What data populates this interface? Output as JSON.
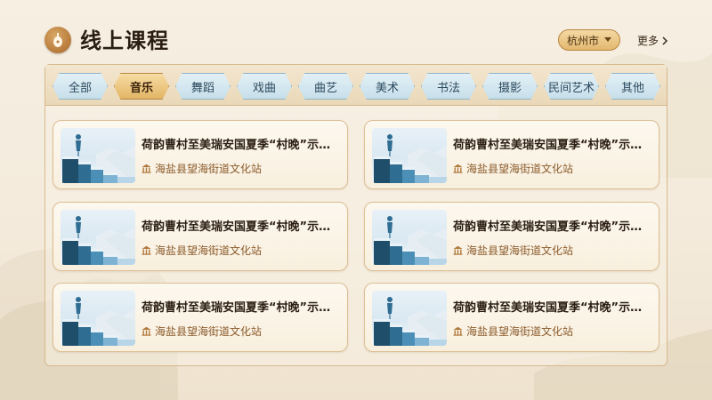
{
  "header": {
    "title": "线上课程",
    "city": "杭州市",
    "more": "更多"
  },
  "tabs": [
    {
      "label": "全部",
      "active": false
    },
    {
      "label": "音乐",
      "active": true
    },
    {
      "label": "舞蹈",
      "active": false
    },
    {
      "label": "戏曲",
      "active": false
    },
    {
      "label": "曲艺",
      "active": false
    },
    {
      "label": "美术",
      "active": false
    },
    {
      "label": "书法",
      "active": false
    },
    {
      "label": "摄影",
      "active": false
    },
    {
      "label": "民间艺术",
      "active": false
    },
    {
      "label": "其他",
      "active": false
    }
  ],
  "cards": [
    {
      "title": "荷韵曹村至美瑞安国夏季“村晚”示范展示活动",
      "venue": "海盐县望海街道文化站",
      "thumb_icon": "books-stairs-thumbnail"
    },
    {
      "title": "荷韵曹村至美瑞安国夏季“村晚”示范展示活动",
      "venue": "海盐县望海街道文化站",
      "thumb_icon": "books-stairs-thumbnail"
    },
    {
      "title": "荷韵曹村至美瑞安国夏季“村晚”示范展示活动",
      "venue": "海盐县望海街道文化站",
      "thumb_icon": "books-stairs-thumbnail"
    },
    {
      "title": "荷韵曹村至美瑞安国夏季“村晚”示范展示活动",
      "venue": "海盐县望海街道文化站",
      "thumb_icon": "books-stairs-thumbnail"
    },
    {
      "title": "荷韵曹村至美瑞安国夏季“村晚”示范展示活动",
      "venue": "海盐县望海街道文化站",
      "thumb_icon": "books-stairs-thumbnail"
    },
    {
      "title": "荷韵曹村至美瑞安国夏季“村晚”示范展示活动",
      "venue": "海盐县望海街道文化站",
      "thumb_icon": "books-stairs-thumbnail"
    }
  ],
  "colors": {
    "accent_gold": "#e2b565",
    "tab_blue": "#c7dfea",
    "venue_brown": "#8a5a2a"
  }
}
